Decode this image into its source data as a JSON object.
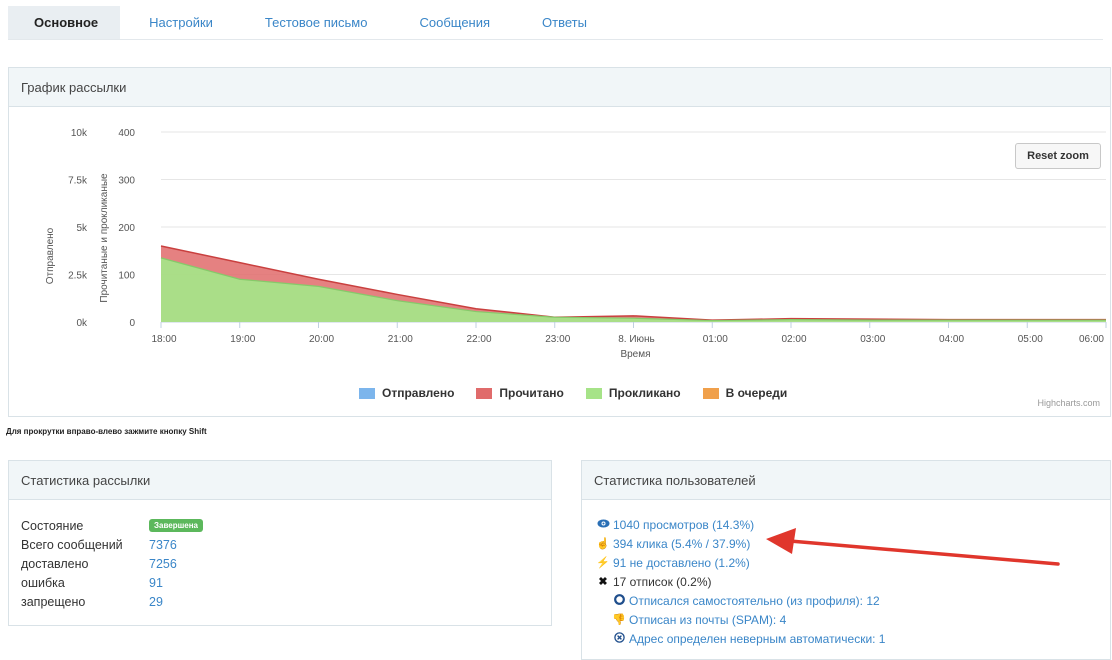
{
  "tabs": [
    "Основное",
    "Настройки",
    "Тестовое письмо",
    "Сообщения",
    "Ответы"
  ],
  "chart_panel": {
    "title": "График рассылки",
    "reset_zoom": "Reset zoom",
    "credits": "Highcharts.com",
    "hint": "Для прокрутки вправо-влево зажмите кнопку Shift"
  },
  "chart_data": {
    "type": "area",
    "x_categories": [
      "18:00",
      "19:00",
      "20:00",
      "21:00",
      "22:00",
      "23:00",
      "8. Июнь",
      "01:00",
      "02:00",
      "03:00",
      "04:00",
      "05:00",
      "06:00"
    ],
    "xlabel": "Время",
    "y_left": {
      "label": "Отправлено",
      "ticks": [
        "0k",
        "2.5k",
        "5k",
        "7.5k",
        "10k"
      ],
      "range": [
        0,
        10000
      ]
    },
    "y_right": {
      "label": "Прочитаные и прокликаные",
      "ticks": [
        "0",
        "100",
        "200",
        "300",
        "400"
      ],
      "range": [
        0,
        400
      ]
    },
    "x_points": [
      0,
      1,
      2,
      3,
      4,
      5,
      6,
      7,
      8,
      9,
      10,
      11,
      12
    ],
    "series": [
      {
        "name": "Отправлено",
        "color": "#7cb5ec",
        "values": [
          0,
          0,
          0,
          0,
          0,
          0,
          0,
          0,
          0,
          0,
          0,
          0,
          0
        ]
      },
      {
        "name": "Прочитано",
        "color": "#e06b6b",
        "values": [
          160,
          125,
          90,
          58,
          28,
          10,
          13,
          4,
          7,
          6,
          5,
          5,
          5
        ]
      },
      {
        "name": "Прокликано",
        "color": "#a6e388",
        "values": [
          135,
          90,
          75,
          45,
          22,
          10,
          8,
          3,
          5,
          4,
          4,
          4,
          4
        ]
      },
      {
        "name": "В очереди",
        "color": "#f0a04b",
        "values": [
          0,
          0,
          0,
          0,
          0,
          0,
          0,
          0,
          0,
          0,
          0,
          0,
          0
        ]
      }
    ],
    "legend_position": "bottom",
    "grid": true
  },
  "stats_panel": {
    "title": "Статистика рассылки",
    "rows": [
      {
        "label": "Состояние",
        "value": "Завершена",
        "badge": true
      },
      {
        "label": "Всего сообщений",
        "value": "7376"
      },
      {
        "label": "доставлено",
        "value": "7256"
      },
      {
        "label": "ошибка",
        "value": "91"
      },
      {
        "label": "запрещено",
        "value": "29"
      }
    ]
  },
  "users_panel": {
    "title": "Статистика пользователей",
    "rows": [
      {
        "icon": "eye-icon",
        "text": "1040 просмотров (14.3%)",
        "link": true
      },
      {
        "icon": "pointer-hand-icon",
        "text": "394 клика (5.4% / 37.9%)",
        "link": true
      },
      {
        "icon": "bolt-icon",
        "text": "91 не доставлено (1.2%)",
        "link": true
      },
      {
        "icon": "x-mark-icon",
        "text": "17 отписок (0.2%)",
        "link": false
      },
      {
        "icon": "circle-ring-icon",
        "text": "Отписался самостоятельно (из профиля): 12",
        "link": true,
        "sub": true
      },
      {
        "icon": "thumbs-down-icon",
        "text": "Отписан из почты (SPAM): 4",
        "link": true,
        "sub": true
      },
      {
        "icon": "circle-x-icon",
        "text": "Адрес определен неверным автоматически: 1",
        "link": true,
        "sub": true
      }
    ]
  },
  "annotation": {
    "color": "#e0362c"
  }
}
